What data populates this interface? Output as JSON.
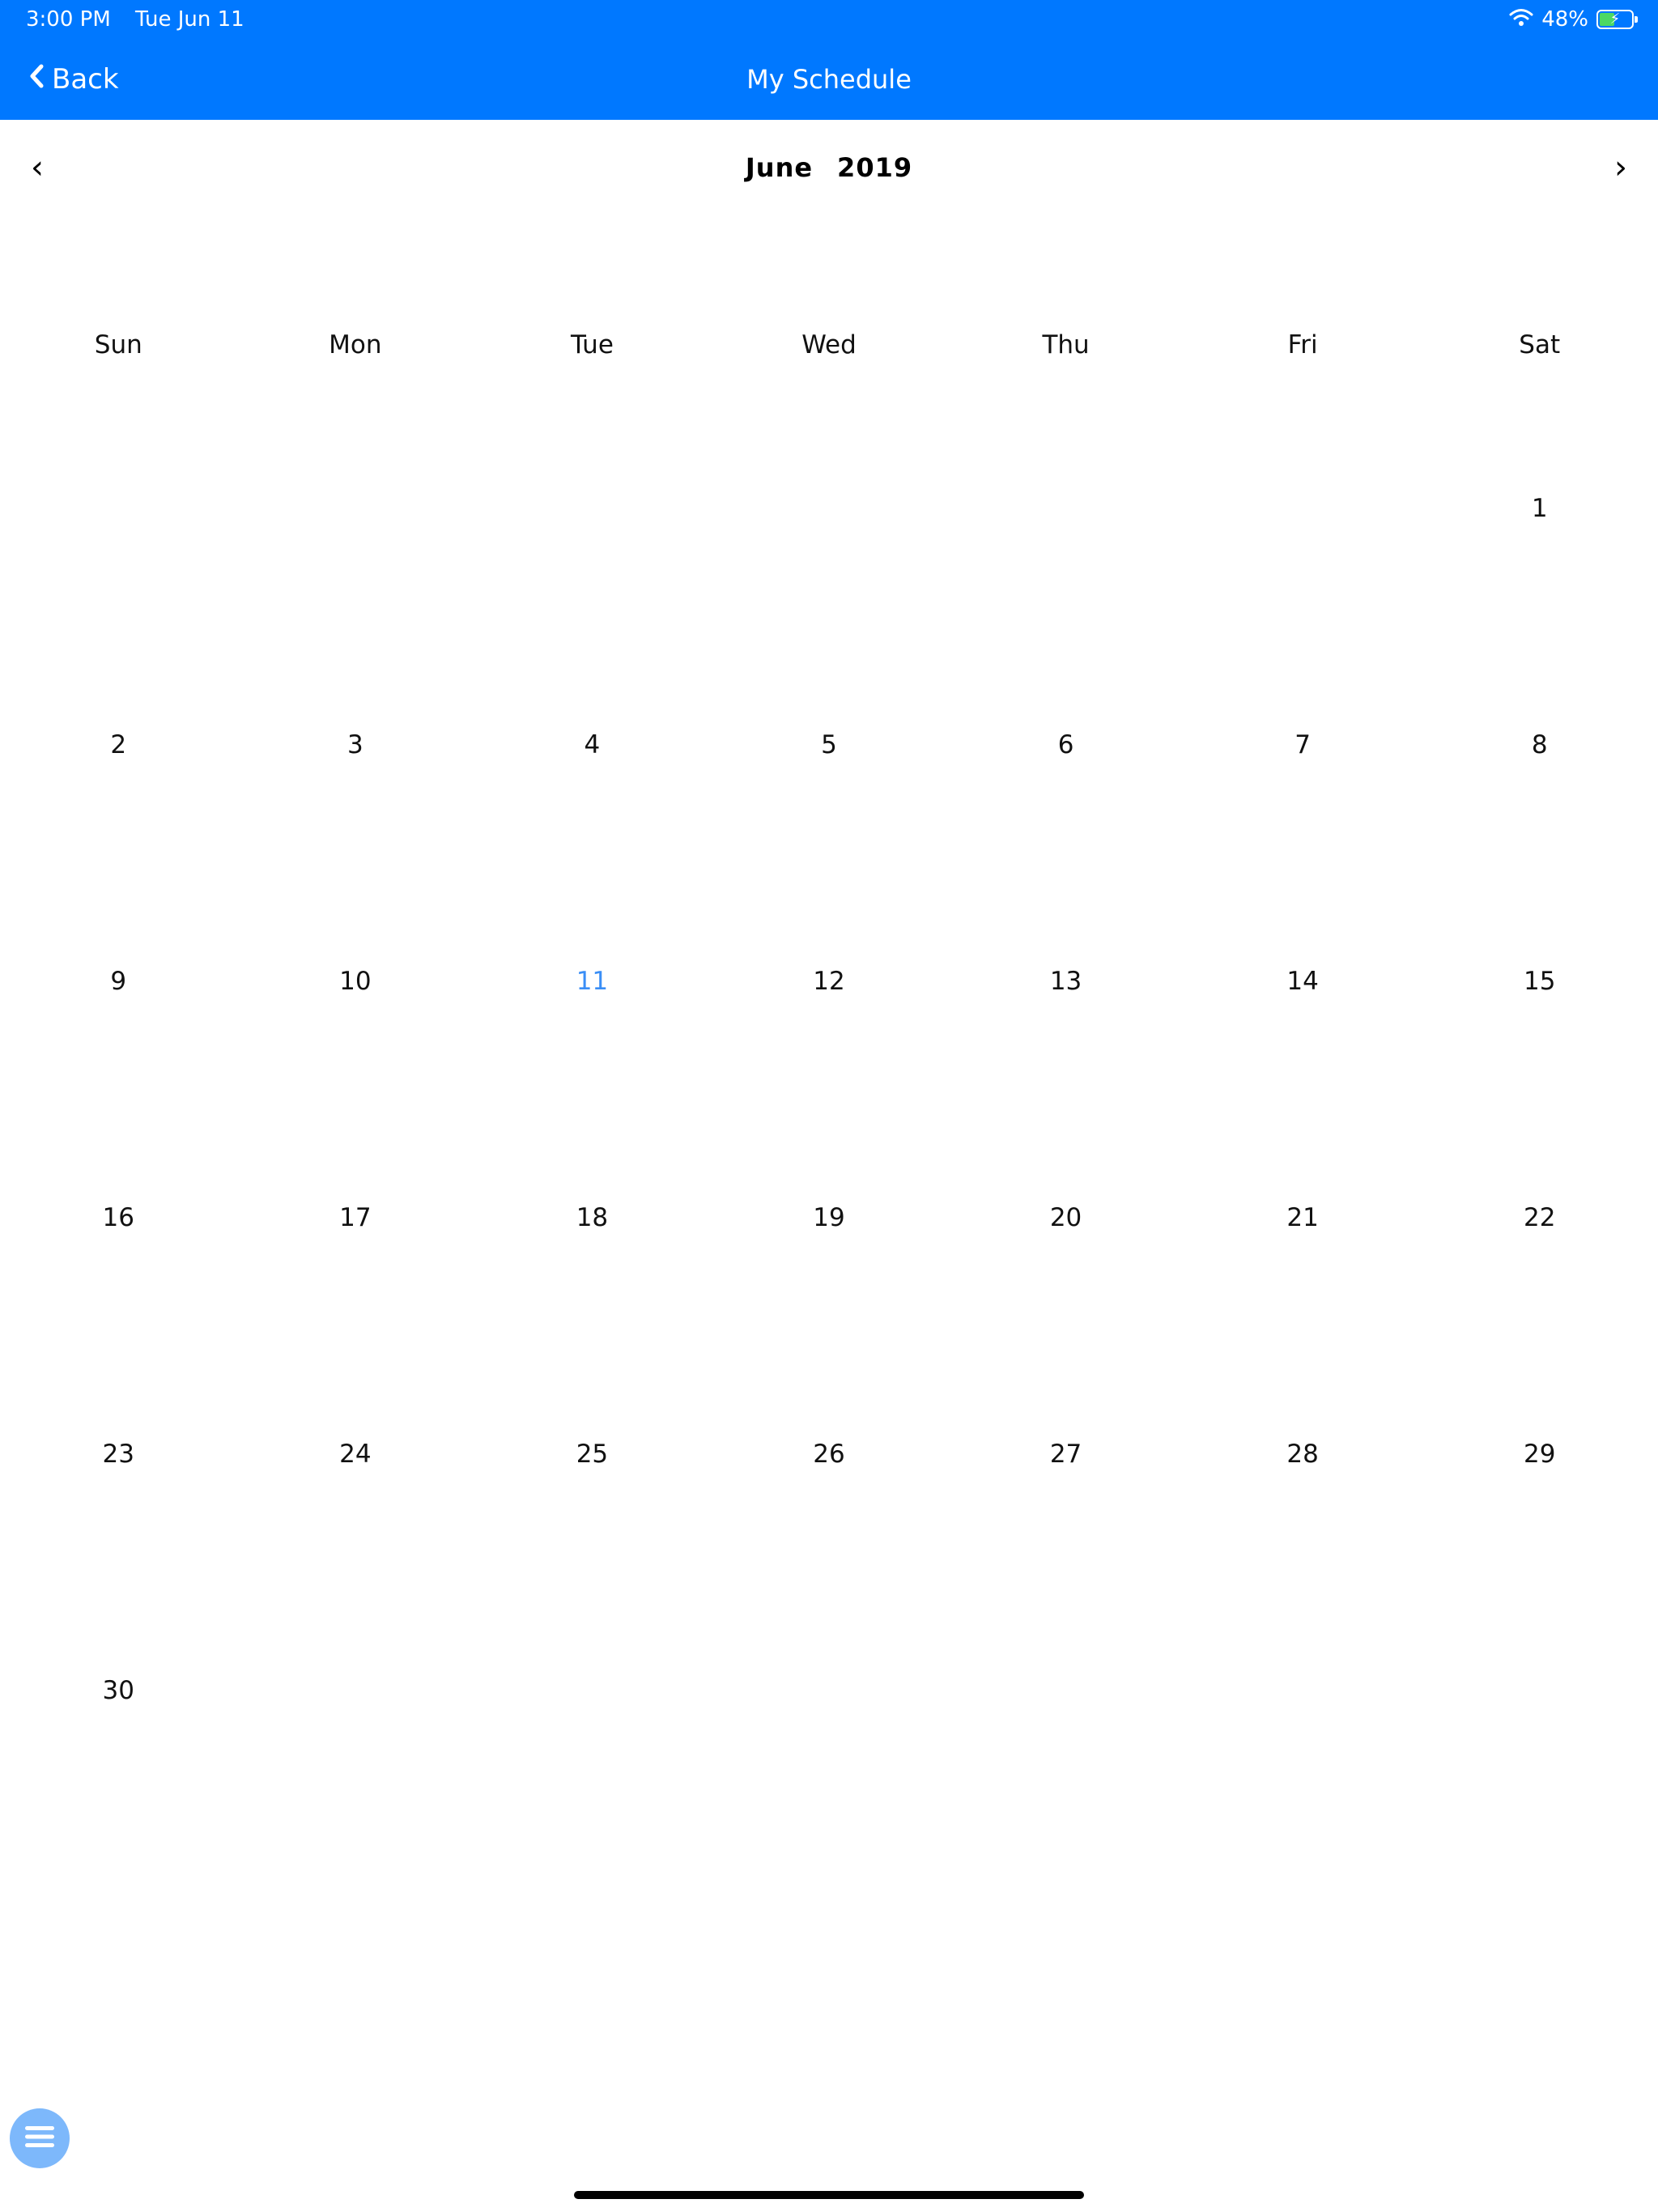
{
  "status_bar": {
    "time": "3:00 PM",
    "date": "Tue Jun 11",
    "battery": "48%",
    "battery_level": 0.48
  },
  "nav": {
    "back_label": "Back",
    "title": "My Schedule"
  },
  "calendar": {
    "month": "June",
    "year": "2019",
    "weekdays": [
      "Sun",
      "Mon",
      "Tue",
      "Wed",
      "Thu",
      "Fri",
      "Sat"
    ],
    "days": [
      [
        "",
        "",
        "",
        "",
        "",
        "",
        "1"
      ],
      [
        "2",
        "3",
        "4",
        "5",
        "6",
        "7",
        "8"
      ],
      [
        "9",
        "10",
        "11",
        "12",
        "13",
        "14",
        "15"
      ],
      [
        "16",
        "17",
        "18",
        "19",
        "20",
        "21",
        "22"
      ],
      [
        "23",
        "24",
        "25",
        "26",
        "27",
        "28",
        "29"
      ],
      [
        "30",
        "",
        "",
        "",
        "",
        "",
        ""
      ]
    ],
    "today": "11"
  },
  "colors": {
    "accent": "#0078ff",
    "today": "#3a8ef6",
    "fab": "#7db8fb"
  },
  "icons": {
    "back": "chevron-left-icon",
    "prev": "chevron-left-icon",
    "next": "chevron-right-icon",
    "menu": "hamburger-menu-icon",
    "wifi": "wifi-icon",
    "battery": "battery-charging-icon"
  }
}
